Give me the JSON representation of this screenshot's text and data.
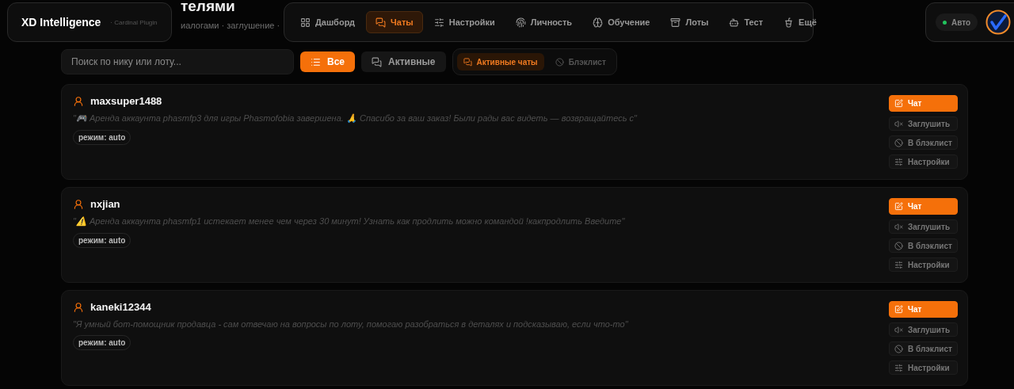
{
  "page": {
    "title": "телями",
    "subtitle": "иалогами · заглушение ·"
  },
  "brand": {
    "name": "XD Intelligence",
    "tagline": "· Cardinal Plugin"
  },
  "nav": [
    {
      "label": "Дашборд",
      "selected": false
    },
    {
      "label": "Чаты",
      "selected": true
    },
    {
      "label": "Настройки",
      "selected": false
    },
    {
      "label": "Личность",
      "selected": false
    },
    {
      "label": "Обучение",
      "selected": false
    },
    {
      "label": "Лоты",
      "selected": false
    },
    {
      "label": "Тест",
      "selected": false
    },
    {
      "label": "Ещё",
      "selected": false
    }
  ],
  "mode": {
    "label": "Авто",
    "on": true
  },
  "search": {
    "placeholder": "Поиск по нику или лоту..."
  },
  "filters": [
    {
      "label": "Все",
      "selected": true
    },
    {
      "label": "Активные",
      "selected": false
    }
  ],
  "segments": [
    {
      "label": "Активные чаты",
      "selected": true
    },
    {
      "label": "Блэклист",
      "selected": false
    }
  ],
  "chats": [
    {
      "user": "maxsuper1488",
      "message": "\"🎮 Аренда аккаунта phasmfp3 для игры Phasmofobia завершена. 🙏 Спасибо за ваш заказ! Были рады вас видеть — возвращайтесь с\"",
      "mode": "режим: auto",
      "actions": [
        {
          "label": "Чат",
          "kind": "primary"
        },
        {
          "label": "Заглушить",
          "kind": "secondary"
        },
        {
          "label": "В блэклист",
          "kind": "secondary"
        },
        {
          "label": "Настройки",
          "kind": "secondary"
        }
      ]
    },
    {
      "user": "nxjian",
      "message": "\"⚠️ Аренда аккаунта phasmfp1 истекает менее чем через 30 минут! Узнать как продлить можно командой !какпродлить Введите\"",
      "mode": "режим: auto",
      "actions": [
        {
          "label": "Чат",
          "kind": "primary"
        },
        {
          "label": "Заглушить",
          "kind": "secondary"
        },
        {
          "label": "В блэклист",
          "kind": "secondary"
        },
        {
          "label": "Настройки",
          "kind": "secondary"
        }
      ]
    },
    {
      "user": "kaneki12344",
      "message": "\"Я умный бот-помощник продавца - сам отвечаю на вопросы по лоту, помогаю разобраться в деталях и подсказываю, если что-то\"",
      "mode": "режим: auto",
      "actions": [
        {
          "label": "Чат",
          "kind": "primary"
        },
        {
          "label": "Заглушить",
          "kind": "secondary"
        },
        {
          "label": "В блэклист",
          "kind": "secondary"
        },
        {
          "label": "Настройки",
          "kind": "secondary"
        }
      ]
    }
  ]
}
